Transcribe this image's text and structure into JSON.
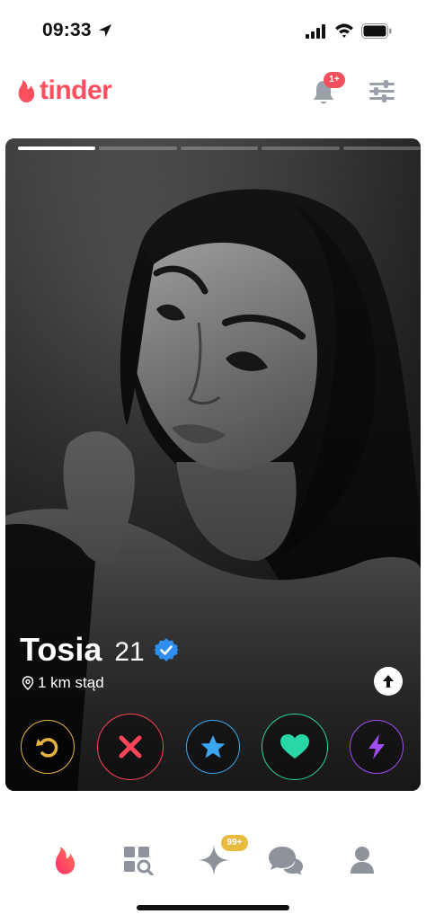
{
  "status_bar": {
    "time": "09:33"
  },
  "header": {
    "brand": "tinder",
    "notification_badge": "1+",
    "colors": {
      "brand": "#fd4f5e",
      "icon": "#9aa0aa"
    }
  },
  "card": {
    "photo_count": 5,
    "active_photo_index": 0,
    "name": "Tosia",
    "age": "21",
    "verified": true,
    "distance": "1 km stąd"
  },
  "actions": [
    {
      "name": "rewind",
      "icon": "rewind-icon",
      "color": "#e9b33f"
    },
    {
      "name": "nope",
      "icon": "x-icon",
      "color": "#ff4458"
    },
    {
      "name": "super-like",
      "icon": "star-icon",
      "color": "#39a7f2"
    },
    {
      "name": "like",
      "icon": "heart-icon",
      "color": "#28d6a6"
    },
    {
      "name": "boost",
      "icon": "bolt-icon",
      "color": "#a14df5"
    }
  ],
  "bottom_nav": {
    "items": [
      {
        "name": "home",
        "icon": "flame-icon",
        "active": true
      },
      {
        "name": "explore",
        "icon": "explore-grid-icon",
        "active": false
      },
      {
        "name": "sparks",
        "icon": "sparkle-icon",
        "active": false
      },
      {
        "name": "chat",
        "icon": "chat-bubbles-icon",
        "active": false
      },
      {
        "name": "profile",
        "icon": "person-icon",
        "active": false
      }
    ],
    "sparks_badge": "99+"
  }
}
